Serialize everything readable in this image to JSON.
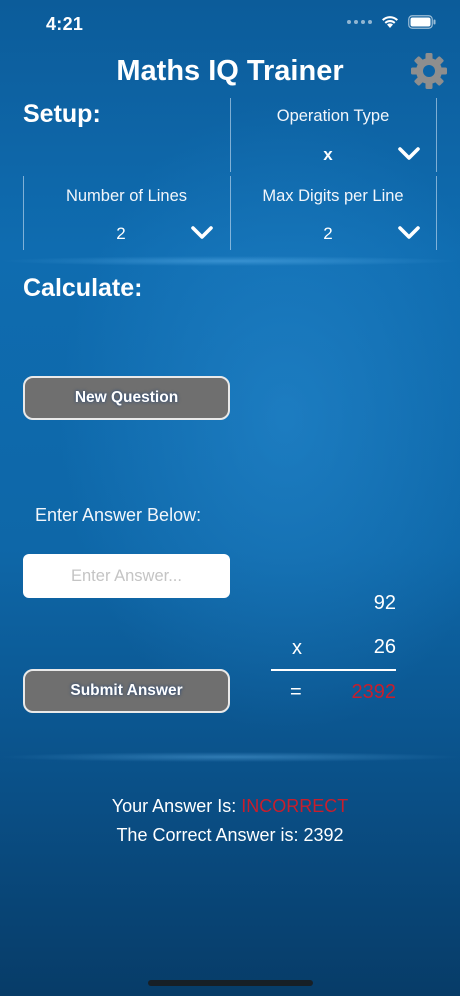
{
  "status_bar": {
    "time": "4:21"
  },
  "header": {
    "title": "Maths IQ Trainer",
    "settings_icon": "gear-icon"
  },
  "setup": {
    "title": "Setup:",
    "operation_type": {
      "label": "Operation Type",
      "value": "x"
    },
    "number_of_lines": {
      "label": "Number of Lines",
      "value": "2"
    },
    "max_digits": {
      "label": "Max Digits per Line",
      "value": "2"
    }
  },
  "calculate": {
    "title": "Calculate:",
    "new_question_label": "New Question",
    "enter_answer_label": "Enter Answer Below:",
    "answer_placeholder": "Enter Answer...",
    "submit_label": "Submit Answer"
  },
  "equation": {
    "line1": "92",
    "operator": "x",
    "line2": "26",
    "equals": "=",
    "result": "2392"
  },
  "feedback": {
    "your_answer_prefix": "Your Answer Is: ",
    "your_answer_status": "INCORRECT",
    "correct_answer_text": "The Correct Answer is: 2392"
  },
  "colors": {
    "background_top": "#0c5c9a",
    "incorrect": "#c81e2c",
    "button_fill": "#6f6f6f"
  }
}
